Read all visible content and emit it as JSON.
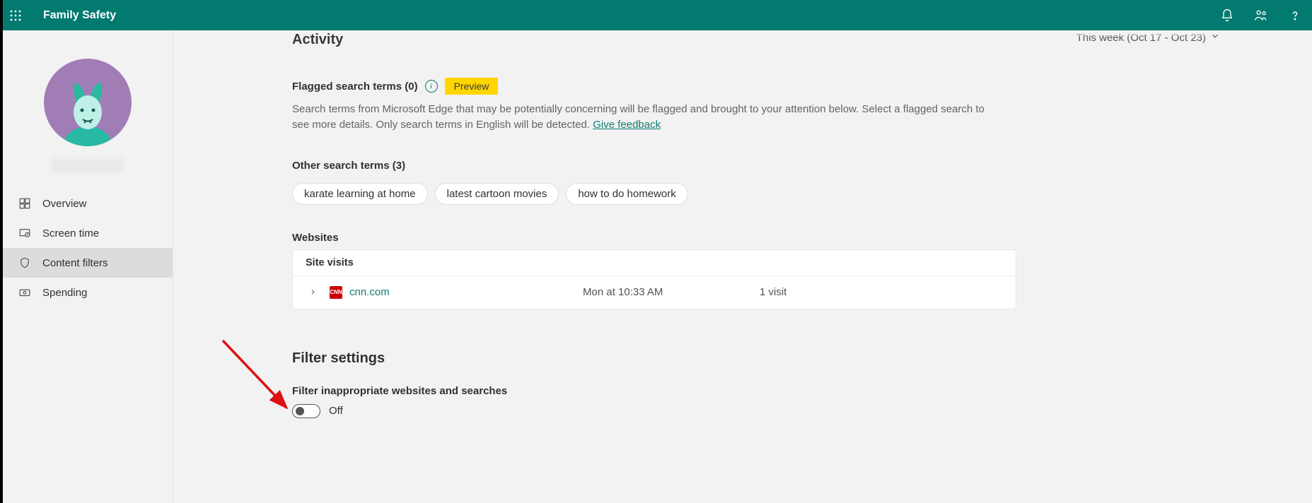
{
  "header": {
    "app_title": "Family Safety"
  },
  "sidebar": {
    "items": [
      {
        "label": "Overview"
      },
      {
        "label": "Screen time"
      },
      {
        "label": "Content filters"
      },
      {
        "label": "Spending"
      }
    ]
  },
  "main": {
    "activity_title": "Activity",
    "date_range": "This week (Oct 17 - Oct 23)",
    "flagged_title": "Flagged search terms (0)",
    "preview_label": "Preview",
    "flagged_desc_a": "Search terms from Microsoft Edge that may be potentially concerning will be flagged and brought to your attention below. Select a flagged search to see more details. Only search terms in English will be detected. ",
    "feedback_label": "Give feedback",
    "other_title": "Other search terms (3)",
    "pills": [
      "karate learning at home",
      "latest cartoon movies",
      "how to do homework"
    ],
    "websites_label": "Websites",
    "table": {
      "head": "Site visits",
      "rows": [
        {
          "favicon_text": "CNN",
          "site": "cnn.com",
          "time": "Mon at 10:33 AM",
          "count": "1 visit"
        }
      ]
    },
    "filter_settings_title": "Filter settings",
    "filter_sub": "Filter inappropriate websites and searches",
    "toggle_state": "Off"
  }
}
